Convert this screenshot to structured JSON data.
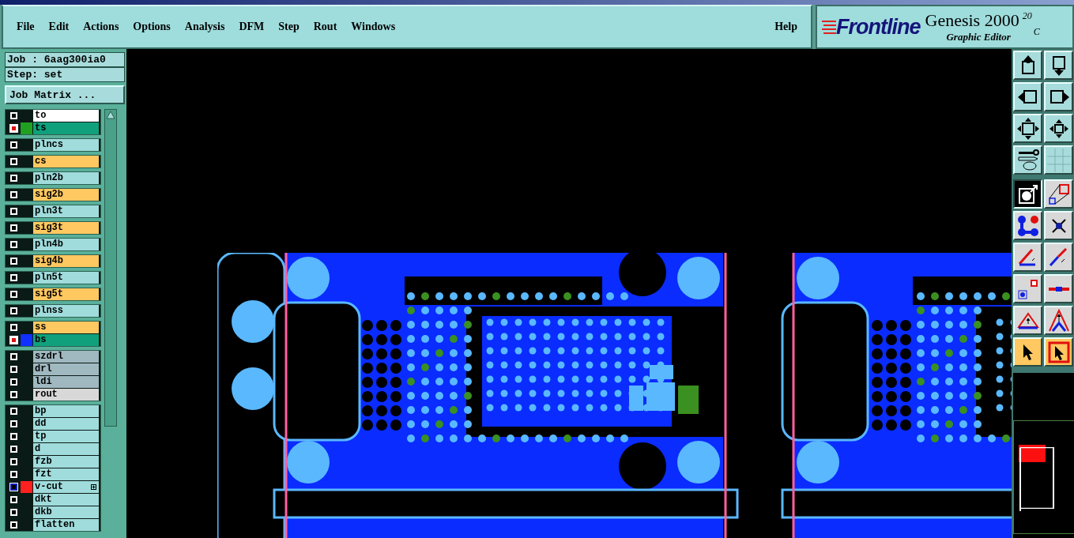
{
  "menu": [
    "File",
    "Edit",
    "Actions",
    "Options",
    "Analysis",
    "DFM",
    "Step",
    "Rout",
    "Windows"
  ],
  "help": "Help",
  "logo": {
    "brand": "Frontline",
    "product": "Genesis 2000",
    "version_mark": "20",
    "corner_mark": "C",
    "subtitle": "Graphic Editor"
  },
  "job": {
    "job_line": "Job : 6aag300ia0",
    "step_line": "Step: set",
    "matrix_button": "Job Matrix ..."
  },
  "layer_groups": [
    {
      "layers": [
        {
          "name": "to",
          "color": "#ffffff",
          "checked": false
        },
        {
          "name": "ts",
          "color": "#10a07c",
          "checked": true,
          "swatch": {
            "color": "#20a020"
          }
        }
      ]
    },
    {
      "layers": [
        {
          "name": "plncs",
          "color": "#a0dcdc",
          "checked": false
        }
      ]
    },
    {
      "layers": [
        {
          "name": "cs",
          "color": "#ffc860",
          "checked": false
        }
      ]
    },
    {
      "layers": [
        {
          "name": "pln2b",
          "color": "#a0dcdc",
          "checked": false
        }
      ]
    },
    {
      "layers": [
        {
          "name": "sig2b",
          "color": "#ffc860",
          "checked": false
        }
      ]
    },
    {
      "layers": [
        {
          "name": "pln3t",
          "color": "#a0dcdc",
          "checked": false
        }
      ]
    },
    {
      "layers": [
        {
          "name": "sig3t",
          "color": "#ffc860",
          "checked": false
        }
      ]
    },
    {
      "layers": [
        {
          "name": "pln4b",
          "color": "#a0dcdc",
          "checked": false
        }
      ]
    },
    {
      "layers": [
        {
          "name": "sig4b",
          "color": "#ffc860",
          "checked": false
        }
      ]
    },
    {
      "layers": [
        {
          "name": "pln5t",
          "color": "#a0dcdc",
          "checked": false
        }
      ]
    },
    {
      "layers": [
        {
          "name": "sig5t",
          "color": "#ffc860",
          "checked": false
        }
      ]
    },
    {
      "layers": [
        {
          "name": "plnss",
          "color": "#a0dcdc",
          "checked": false
        }
      ]
    },
    {
      "layers": [
        {
          "name": "ss",
          "color": "#ffc860",
          "checked": false
        },
        {
          "name": "bs",
          "color": "#10a07c",
          "checked": true,
          "swatch": {
            "color": "#1030ff"
          }
        }
      ]
    },
    {
      "layers": [
        {
          "name": "szdrl",
          "color": "#a0b8c0",
          "checked": false
        },
        {
          "name": "drl",
          "color": "#a0b8c0",
          "checked": false
        },
        {
          "name": "ldi",
          "color": "#a0b8c0",
          "checked": false
        },
        {
          "name": "rout",
          "color": "#d8d8d8",
          "checked": false
        }
      ]
    },
    {
      "layers": [
        {
          "name": "bp",
          "color": "#a0dcdc",
          "checked": false
        },
        {
          "name": "dd",
          "color": "#a0dcdc",
          "checked": false
        },
        {
          "name": "tp",
          "color": "#a0dcdc",
          "checked": false
        },
        {
          "name": "d",
          "color": "#a0dcdc",
          "checked": false
        },
        {
          "name": "fzb",
          "color": "#a0dcdc",
          "checked": false
        },
        {
          "name": "fzt",
          "color": "#a0dcdc",
          "checked": false
        },
        {
          "name": "v-cut",
          "color": "#a0dcdc",
          "checked": false,
          "focused": true,
          "swatch": {
            "color": "#ff2020"
          },
          "marked": true
        },
        {
          "name": "dkt",
          "color": "#a0dcdc",
          "checked": false
        },
        {
          "name": "dkb",
          "color": "#a0dcdc",
          "checked": false
        },
        {
          "name": "flatten",
          "color": "#a0dcdc",
          "checked": false
        }
      ]
    }
  ],
  "view_tools": [
    {
      "kind": "up"
    },
    {
      "kind": "down"
    },
    {
      "kind": "left"
    },
    {
      "kind": "right"
    },
    {
      "kind": "fit"
    },
    {
      "kind": "zoom"
    },
    {
      "kind": "palette"
    },
    {
      "kind": "grid"
    }
  ],
  "edit_tools": [
    {
      "kind": "shape",
      "selected": true,
      "highlighted": false
    },
    {
      "kind": "copy",
      "selected": false,
      "highlighted": false
    },
    {
      "kind": "nodes",
      "selected": false,
      "highlighted": false
    },
    {
      "kind": "cross",
      "selected": false,
      "highlighted": false
    },
    {
      "kind": "line-a",
      "selected": false,
      "highlighted": false
    },
    {
      "kind": "line-b",
      "selected": false,
      "highlighted": false
    },
    {
      "kind": "move",
      "selected": false,
      "highlighted": false
    },
    {
      "kind": "bar",
      "selected": false,
      "highlighted": false
    },
    {
      "kind": "triangle",
      "selected": false,
      "highlighted": false
    },
    {
      "kind": "peak",
      "selected": false,
      "highlighted": false
    },
    {
      "kind": "pointer",
      "selected": false,
      "highlighted": true
    },
    {
      "kind": "pointer-frame",
      "selected": false,
      "highlighted": true
    }
  ]
}
